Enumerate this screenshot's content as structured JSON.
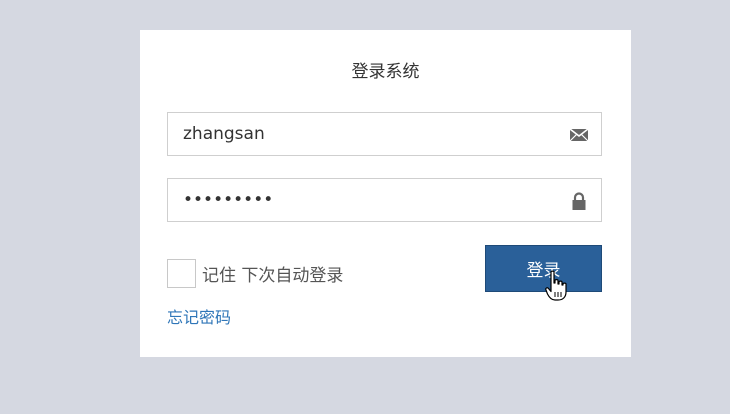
{
  "login_card": {
    "title": "登录系统",
    "username": {
      "value": "zhangsan",
      "icon": "envelope-icon"
    },
    "password": {
      "value": "123456789",
      "icon": "lock-icon"
    },
    "remember_label": "记住 下次自动登录",
    "remember_checked": false,
    "login_button_label": "登录",
    "forgot_password_label": "忘记密码"
  },
  "colors": {
    "background": "#d5d8e1",
    "card": "#ffffff",
    "button": "#2a6099",
    "link": "#2f76b8"
  }
}
